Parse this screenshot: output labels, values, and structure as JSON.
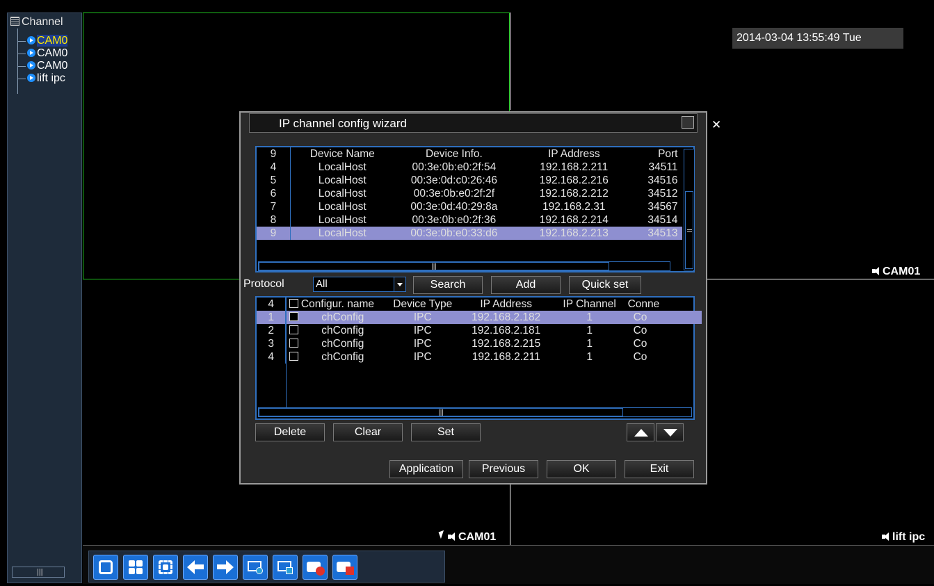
{
  "sidebar": {
    "title": "Channel",
    "items": [
      {
        "label": "CAM0",
        "selected": true
      },
      {
        "label": "CAM0",
        "selected": false
      },
      {
        "label": "CAM0",
        "selected": false
      },
      {
        "label": "lift ipc",
        "selected": false
      }
    ],
    "scroll_glyph": "|||"
  },
  "video": {
    "datetime": "2014-03-04 13:55:49 Tue",
    "labels": {
      "right_mid": "CAM01",
      "bottom_left": "CAM01",
      "bottom_right": "lift ipc"
    },
    "grid_color_active": "#1fc41f"
  },
  "dialog": {
    "title": "IP channel config wizard",
    "close_glyph": "✕",
    "search_table": {
      "columns": [
        "9",
        "Device Name",
        "Device Info.",
        "IP Address",
        "Port"
      ],
      "rows": [
        {
          "n": "4",
          "name": "LocalHost",
          "info": "00:3e:0b:e0:2f:54",
          "ip": "192.168.2.211",
          "port": "34511"
        },
        {
          "n": "5",
          "name": "LocalHost",
          "info": "00:3e:0d:c0:26:46",
          "ip": "192.168.2.216",
          "port": "34516"
        },
        {
          "n": "6",
          "name": "LocalHost",
          "info": "00:3e:0b:e0:2f:2f",
          "ip": "192.168.2.212",
          "port": "34512"
        },
        {
          "n": "7",
          "name": "LocalHost",
          "info": "00:3e:0d:40:29:8a",
          "ip": "192.168.2.31",
          "port": "34567"
        },
        {
          "n": "8",
          "name": "LocalHost",
          "info": "00:3e:0b:e0:2f:36",
          "ip": "192.168.2.214",
          "port": "34514"
        },
        {
          "n": "9",
          "name": "LocalHost",
          "info": "00:3e:0b:e0:33:d6",
          "ip": "192.168.2.213",
          "port": "34513"
        }
      ],
      "selected_row": "9"
    },
    "protocol_label": "Protocol",
    "protocol_value": "All",
    "buttons_top": {
      "search": "Search",
      "add": "Add",
      "quick_set": "Quick set"
    },
    "config_table": {
      "columns": [
        "4",
        "Configur. name",
        "Device Type",
        "IP Address",
        "IP Channel",
        "Conne"
      ],
      "rows": [
        {
          "n": "1",
          "name": "chConfig",
          "type": "IPC",
          "ip": "192.168.2.182",
          "chan": "1",
          "conn": "Co"
        },
        {
          "n": "2",
          "name": "chConfig",
          "type": "IPC",
          "ip": "192.168.2.181",
          "chan": "1",
          "conn": "Co"
        },
        {
          "n": "3",
          "name": "chConfig",
          "type": "IPC",
          "ip": "192.168.2.215",
          "chan": "1",
          "conn": "Co"
        },
        {
          "n": "4",
          "name": "chConfig",
          "type": "IPC",
          "ip": "192.168.2.211",
          "chan": "1",
          "conn": "Co"
        }
      ],
      "selected_row": "1"
    },
    "buttons_mid": {
      "delete": "Delete",
      "clear": "Clear",
      "set": "Set"
    },
    "buttons_bottom": {
      "application": "Application",
      "previous": "Previous",
      "ok": "OK",
      "exit": "Exit"
    },
    "scroll_glyph": "|||"
  },
  "toolbar": {
    "icons": [
      "single-view-icon",
      "quad-view-icon",
      "fullscreen-icon",
      "previous-page-icon",
      "next-page-icon",
      "playback-icon",
      "monitor-icon",
      "record-start-icon",
      "record-stop-icon"
    ]
  },
  "colors": {
    "accent_blue": "#1a6fd6",
    "selection": "#8e8fd0",
    "border_blue": "#2f6fbe"
  }
}
